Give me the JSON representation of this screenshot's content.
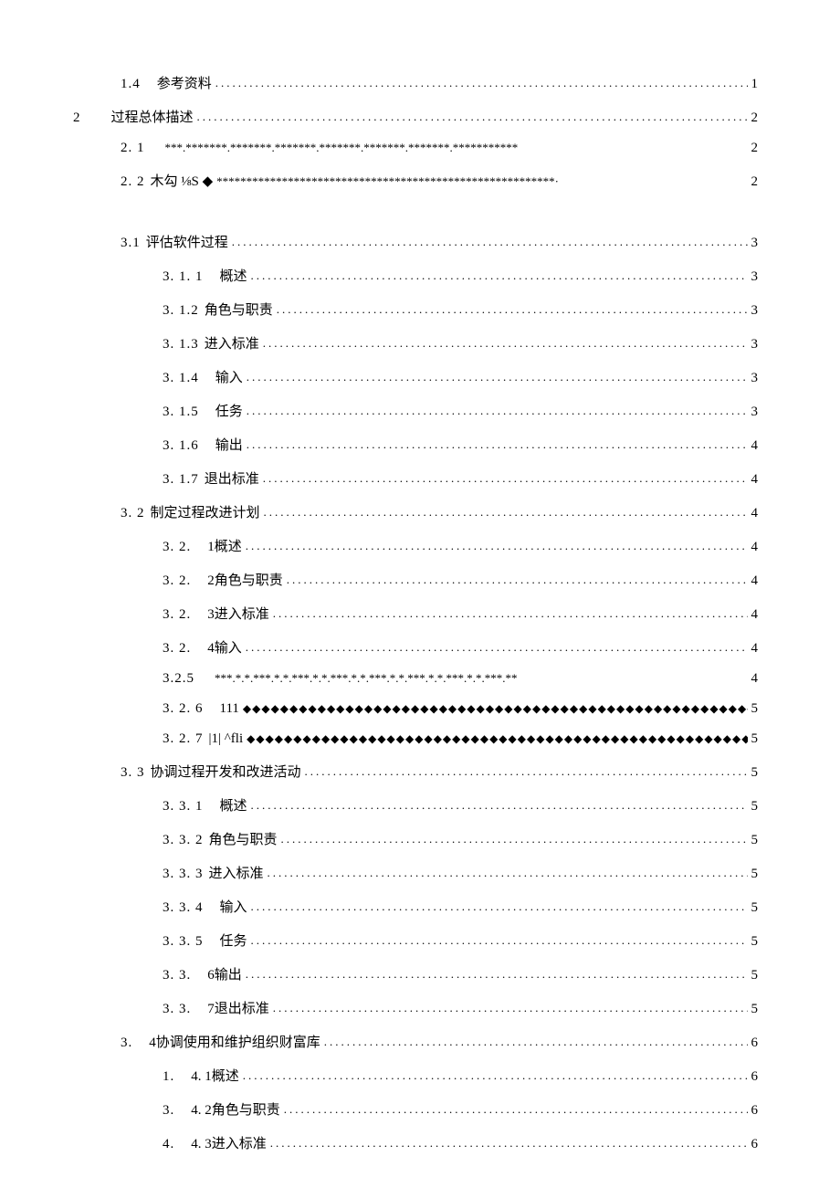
{
  "entries": [
    {
      "indent": "indent-1",
      "num": "1.4",
      "gap": "wide-space",
      "title": "参考资料",
      "fill": "dots",
      "page": "1"
    },
    {
      "chapter": "2",
      "indent": "indent-0",
      "num": "",
      "gap": "",
      "title": "过程总体描述",
      "fill": "dots",
      "page": "2"
    },
    {
      "indent": "indent-1",
      "num": "2. 1",
      "gap": "wide-space",
      "title": "",
      "fill": "stars1",
      "page": "2"
    },
    {
      "indent": "indent-1",
      "num": "2. 2",
      "gap": "",
      "title": "木勾  ⅛S ◆",
      "fill": "stars2",
      "page": "2"
    },
    {
      "spacer": true
    },
    {
      "indent": "indent-2",
      "num": "3.1",
      "gap": "",
      "title": "评估软件过程",
      "fill": "dots",
      "page": "3"
    },
    {
      "indent": "indent-3",
      "num": "3. 1. 1",
      "gap": "wide-space",
      "title": "概述 ",
      "fill": "dots",
      "page": "3"
    },
    {
      "indent": "indent-3",
      "num": "3. 1.2",
      "gap": "",
      "title": "角色与职责",
      "fill": "dots",
      "page": "3"
    },
    {
      "indent": "indent-3",
      "num": "3. 1.3",
      "gap": "",
      "title": "进入标准",
      "fill": "dots",
      "page": "3"
    },
    {
      "indent": "indent-3",
      "num": "3. 1.4",
      "gap": "wide-space",
      "title": "输入 ",
      "fill": "dots",
      "page": "3"
    },
    {
      "indent": "indent-3",
      "num": "3. 1.5",
      "gap": "wide-space",
      "title": "任务 ",
      "fill": "dots",
      "page": "3"
    },
    {
      "indent": "indent-3",
      "num": "3. 1.6",
      "gap": "wide-space",
      "title": "输出 ",
      "fill": "dots",
      "page": "4"
    },
    {
      "indent": "indent-3",
      "num": "3. 1.7",
      "gap": "",
      "title": "退出标准",
      "fill": "dots",
      "page": "4"
    },
    {
      "indent": "indent-2",
      "num": "3. 2",
      "gap": "",
      "title": "制定过程改进计划 ",
      "fill": "dots",
      "page": "4"
    },
    {
      "indent": "indent-3",
      "num": "3. 2.",
      "gap": "wide-space",
      "title": "1概述 ",
      "fill": "dots",
      "page": "4"
    },
    {
      "indent": "indent-3",
      "num": "3. 2.",
      "gap": "wide-space",
      "title": "2角色与职责 ",
      "fill": "dots",
      "page": "4"
    },
    {
      "indent": "indent-3",
      "num": "3. 2.",
      "gap": "wide-space",
      "title": "3进入标准 ",
      "fill": "dots",
      "page": "4"
    },
    {
      "indent": "indent-3",
      "num": "3. 2.",
      "gap": "wide-space",
      "title": "4输入 ",
      "fill": "dots",
      "page": "4"
    },
    {
      "indent": "indent-3",
      "num": "3.2.5",
      "gap": "wide-space",
      "title": "",
      "fill": "stars3",
      "page": "4"
    },
    {
      "indent": "indent-3",
      "num": "3. 2. 6",
      "gap": "wide-space",
      "title": "111",
      "fill": "diamonds",
      "page": " 5"
    },
    {
      "indent": "indent-3",
      "num": "3. 2. 7",
      "gap": "",
      "title": " |1| ^fli ",
      "fill": "diamonds",
      "page": " 5"
    },
    {
      "indent": "indent-2",
      "num": "3. 3",
      "gap": "",
      "title": "协调过程开发和改进活动 ",
      "fill": "dots",
      "page": "5"
    },
    {
      "indent": "indent-3",
      "num": "3. 3. 1",
      "gap": "wide-space",
      "title": "概述 ",
      "fill": "dots",
      "page": "5"
    },
    {
      "indent": "indent-3",
      "num": "3. 3. 2",
      "gap": "",
      "title": "角色与职责 ",
      "fill": "dots",
      "page": "5"
    },
    {
      "indent": "indent-3",
      "num": "3. 3. 3",
      "gap": "",
      "title": "进入标准 ",
      "fill": "dots",
      "page": "5"
    },
    {
      "indent": "indent-3",
      "num": "3. 3. 4",
      "gap": "wide-space",
      "title": "输入 ",
      "fill": "dots",
      "page": "5"
    },
    {
      "indent": "indent-3",
      "num": "3. 3. 5",
      "gap": "wide-space",
      "title": "任务 ",
      "fill": "dots",
      "page": "5"
    },
    {
      "indent": "indent-3",
      "num": "3. 3.",
      "gap": "wide-space",
      "title": "6输出 ",
      "fill": "dots",
      "page": "5"
    },
    {
      "indent": "indent-3",
      "num": "3. 3.",
      "gap": "wide-space",
      "title": "7退出标准",
      "fill": "dots",
      "page": "5"
    },
    {
      "indent": "indent-2",
      "num": "3.",
      "gap": "wide-space",
      "title": "4协调使用和维护组织财富库 ",
      "fill": "dots",
      "page": "6"
    },
    {
      "indent": "indent-3",
      "num": "1.",
      "gap": "wide-space",
      "title": "4. 1概述 ",
      "fill": "dots",
      "page": "6"
    },
    {
      "indent": "indent-3",
      "num": "3.",
      "gap": "wide-space",
      "title": "4. 2角色与职责",
      "fill": "dots",
      "page": "6"
    },
    {
      "indent": "indent-3",
      "num": "4.",
      "gap": "wide-space",
      "title": "4. 3进入标准",
      "fill": "dots",
      "page": "6"
    }
  ],
  "fills": {
    "stars1": "***.*******.*******.*******.*******.*******.*******.***********",
    "stars2": " *********************************************************·",
    "stars3": " ***.*.*.***.*.*.***.*.*.***.*.*.***.*.*.***.*.*.***.*.*.***.**",
    "diamonds": "◆◆◆◆◆◆◆◆◆◆◆◆◆◆◆◆◆◆◆◆◆◆◆◆◆◆◆◆◆◆◆◆◆◆◆◆◆◆◆◆◆◆◆◆◆◆◆◆◆◆◆◆◆◆◆◆◆◆◆◆◆◆◆◆◆◆◆◆◆◆"
  }
}
